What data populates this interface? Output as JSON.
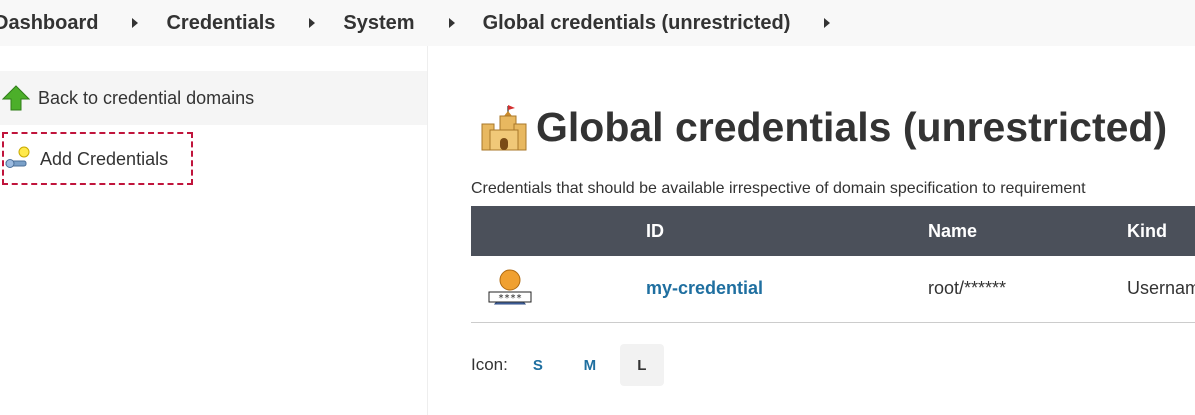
{
  "breadcrumb": [
    "Dashboard",
    "Credentials",
    "System",
    "Global credentials (unrestricted)"
  ],
  "sidebar": {
    "back_label": "Back to credential domains",
    "add_label": "Add Credentials"
  },
  "main": {
    "title": "Global credentials (unrestricted)",
    "description": "Credentials that should be available irrespective of domain specification to requirement",
    "table": {
      "headers": [
        "ID",
        "Name",
        "Kind"
      ],
      "rows": [
        {
          "id": "my-credential",
          "name": "root/******",
          "kind": "Usernam"
        }
      ]
    },
    "icon_size": {
      "label": "Icon:",
      "options": [
        "S",
        "M",
        "L"
      ],
      "selected": "L"
    }
  },
  "colors": {
    "header_bg": "#4b505a",
    "link": "#1f6fa0",
    "focus": "#c0143c"
  }
}
